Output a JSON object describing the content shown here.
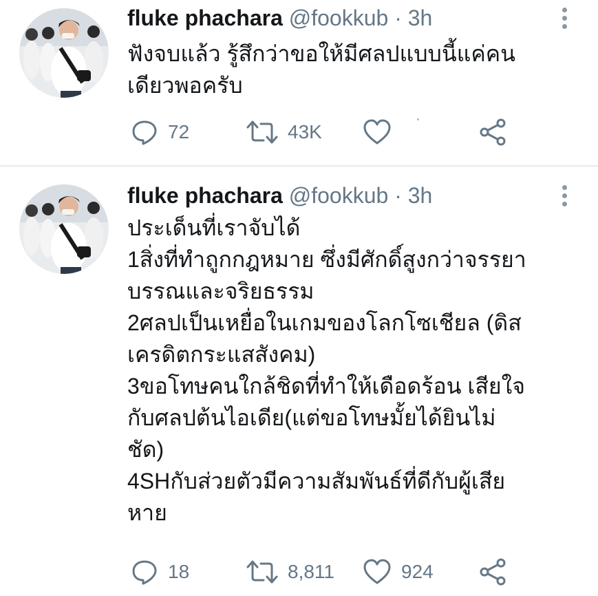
{
  "tweets": [
    {
      "name": "fluke phachara",
      "handle": "@fookkub",
      "separator": "·",
      "time": "3h",
      "lines": [
        "ฟังจบแล้ว รู้สึกว่าขอให้มีศลปแบบนี้แค่คน",
        "เดียวพอครับ"
      ],
      "replies": "72",
      "retweets": "43K",
      "likes": ""
    },
    {
      "name": "fluke phachara",
      "handle": "@fookkub",
      "separator": "·",
      "time": "3h",
      "lines": [
        "ประเด็นที่เราจับได้",
        "1สิ่งที่ทำถูกกฎหมาย ซึ่งมีศักดิ์สูงกว่าจรรยา",
        "บรรณและจริยธรรม",
        "2ศลปเป็นเหยื่อในเกมของโลกโซเชียล (ดิส",
        "เครดิตกระแสสังคม)",
        "3ขอโทษคนใกล้ชิดที่ทำให้เดือดร้อน เสียใจ",
        "กับศลปต้นไอเดีย(แต่ขอโทษมั้ยได้ยินไม่",
        "ชัด)",
        "4SHกับส่วยตัวมีความสัมพันธ์ที่ดีกับผู้เสีย",
        "หาย"
      ],
      "replies": "18",
      "retweets": "8,811",
      "likes": "924"
    }
  ],
  "icons": {
    "reply": "reply-icon",
    "retweet": "retweet-icon",
    "like": "heart-icon",
    "share": "share-icon",
    "more": "more-options-icon"
  },
  "colors": {
    "text": "#14171a",
    "secondary": "#657786",
    "divider": "#e6ecf0"
  }
}
